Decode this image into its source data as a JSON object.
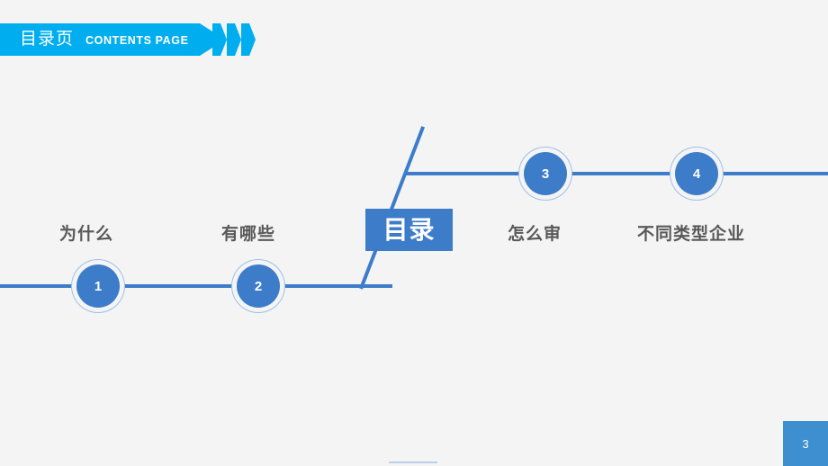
{
  "header": {
    "title_cn": "目录页",
    "title_en": "CONTENTS PAGE",
    "bar_color": "#00aeef",
    "chevron_count": 3
  },
  "center": {
    "label": "目录",
    "box_color": "#3d7cc9"
  },
  "items": [
    {
      "number": "1",
      "label": "为什么"
    },
    {
      "number": "2",
      "label": "有哪些"
    },
    {
      "number": "3",
      "label": "怎么审"
    },
    {
      "number": "4",
      "label": "不同类型企业"
    }
  ],
  "colors": {
    "background": "#f4f4f4",
    "accent_blue": "#3d7cc9",
    "accent_cyan": "#00aeef",
    "node_ring": "#9fc0e4",
    "caption_text": "#595959",
    "page_badge": "#3d8fcf"
  },
  "footer": {
    "page_number": "3"
  }
}
